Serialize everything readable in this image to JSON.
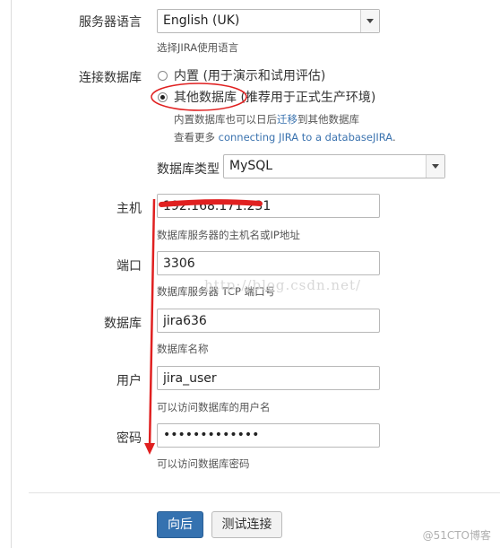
{
  "server_language": {
    "label": "服务器语言",
    "value": "English (UK)",
    "help": "选择JIRA使用语言"
  },
  "database_connection": {
    "label": "连接数据库",
    "options": [
      {
        "label": "内置 (用于演示和试用评估)",
        "selected": false
      },
      {
        "label": "其他数据库 (推荐用于正式生产环境)",
        "selected": true
      }
    ],
    "help_line1_pre": "内置数据库也可以日后",
    "help_line1_link": "迁移",
    "help_line1_post": "到其他数据库",
    "help_line2_pre": "查看更多",
    "help_line2_link": "connecting JIRA to a databaseJIRA",
    "help_line2_post": "."
  },
  "database_type": {
    "label": "数据库类型",
    "value": "MySQL"
  },
  "host": {
    "label": "主机",
    "value": "192.168.171.231",
    "help": "数据库服务器的主机名或IP地址"
  },
  "port": {
    "label": "端口",
    "value": "3306",
    "help": "数据库服务器 TCP 端口号"
  },
  "database": {
    "label": "数据库",
    "value": "jira636",
    "help": "数据库名称"
  },
  "user": {
    "label": "用户",
    "value": "jira_user",
    "help": "可以访问数据库的用户名"
  },
  "password": {
    "label": "密码",
    "value": "•••••••••••••",
    "help": "可以访问数据库密码"
  },
  "actions": {
    "next_label": "向后",
    "test_label": "测试连接"
  },
  "watermarks": {
    "url": "http://blog.csdn.net/",
    "logo": "@51CTO博客"
  },
  "annotation_colors": {
    "red": "#e02020"
  }
}
